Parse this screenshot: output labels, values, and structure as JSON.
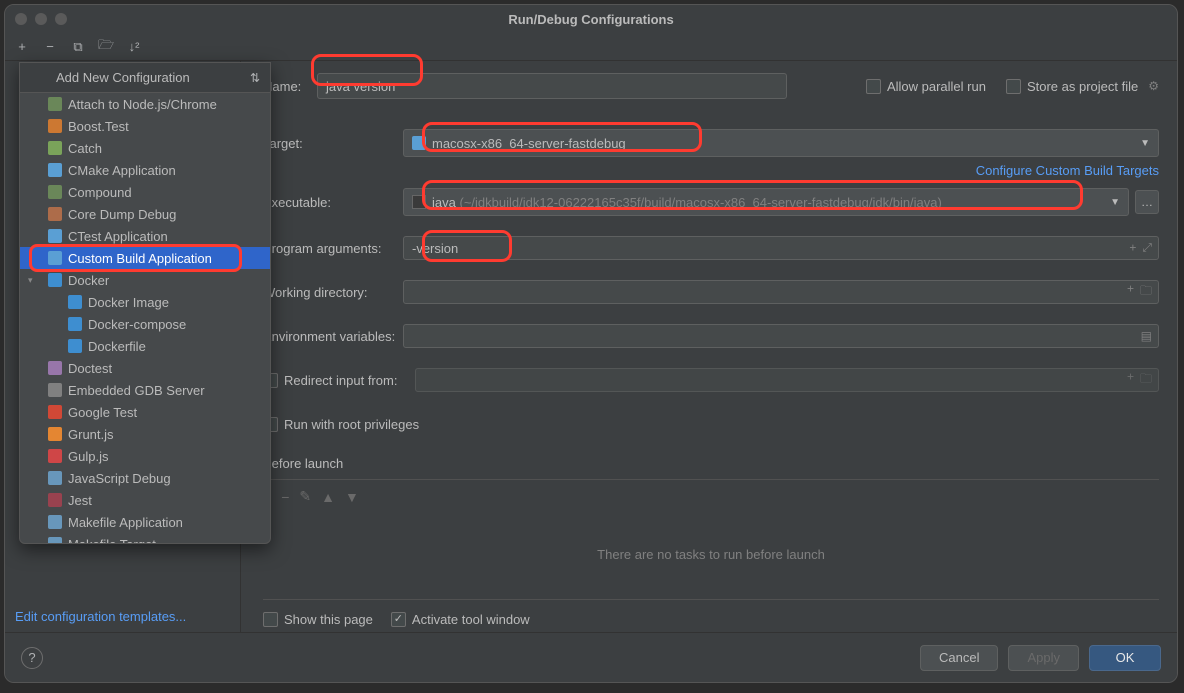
{
  "title": "Run/Debug Configurations",
  "toolbar": {
    "add": "+",
    "remove": "−"
  },
  "name_label": "Name:",
  "name_value": "java version",
  "allow_parallel": "Allow parallel run",
  "store_as_file": "Store as project file",
  "target_label": "Target:",
  "target_value": "macosx-x86_64-server-fastdebug",
  "configure_link": "Configure Custom Build Targets",
  "executable_label": "Executable:",
  "executable_name": "java",
  "executable_path": "(~/jdkbuild/jdk12-06222165c35f/build/macosx-x86_64-server-fastdebug/jdk/bin/java)",
  "program_args_label": "Program arguments:",
  "program_args_value": "-version",
  "working_dir_label": "Working directory:",
  "env_vars_label": "Environment variables:",
  "redirect_label": "Redirect input from:",
  "root_priv_label": "Run with root privileges",
  "before_launch_label": "Before launch",
  "no_tasks_text": "There are no tasks to run before launch",
  "show_page": "Show this page",
  "activate_tool": "Activate tool window",
  "edit_templates": "Edit configuration templates...",
  "footer": {
    "cancel": "Cancel",
    "apply": "Apply",
    "ok": "OK"
  },
  "popup": {
    "header": "Add New Configuration",
    "items": [
      {
        "label": "Attach to Node.js/Chrome",
        "icon": "#6a8759",
        "child": false
      },
      {
        "label": "Boost.Test",
        "icon": "#cc7832",
        "child": false
      },
      {
        "label": "Catch",
        "icon": "#7aa35a",
        "child": false
      },
      {
        "label": "CMake Application",
        "icon": "#5a9fd4",
        "child": false
      },
      {
        "label": "Compound",
        "icon": "#6a8759",
        "child": false
      },
      {
        "label": "Core Dump Debug",
        "icon": "#ad6c4a",
        "child": false
      },
      {
        "label": "CTest Application",
        "icon": "#5a9fd4",
        "child": false
      },
      {
        "label": "Custom Build Application",
        "icon": "#5a9fd4",
        "child": false,
        "selected": true
      },
      {
        "label": "Docker",
        "icon": "#3e8ed0",
        "child": false,
        "expandable": true
      },
      {
        "label": "Docker Image",
        "icon": "#3e8ed0",
        "child": true
      },
      {
        "label": "Docker-compose",
        "icon": "#3e8ed0",
        "child": true
      },
      {
        "label": "Dockerfile",
        "icon": "#3e8ed0",
        "child": true
      },
      {
        "label": "Doctest",
        "icon": "#9876aa",
        "child": false
      },
      {
        "label": "Embedded GDB Server",
        "icon": "#808080",
        "child": false
      },
      {
        "label": "Google Test",
        "icon": "#d14836",
        "child": false
      },
      {
        "label": "Grunt.js",
        "icon": "#e48632",
        "child": false
      },
      {
        "label": "Gulp.js",
        "icon": "#cf4647",
        "child": false
      },
      {
        "label": "JavaScript Debug",
        "icon": "#6897bb",
        "child": false
      },
      {
        "label": "Jest",
        "icon": "#99424f",
        "child": false
      },
      {
        "label": "Makefile Application",
        "icon": "#6897bb",
        "child": false
      },
      {
        "label": "Makefile Target",
        "icon": "#6897bb",
        "child": false
      }
    ]
  }
}
